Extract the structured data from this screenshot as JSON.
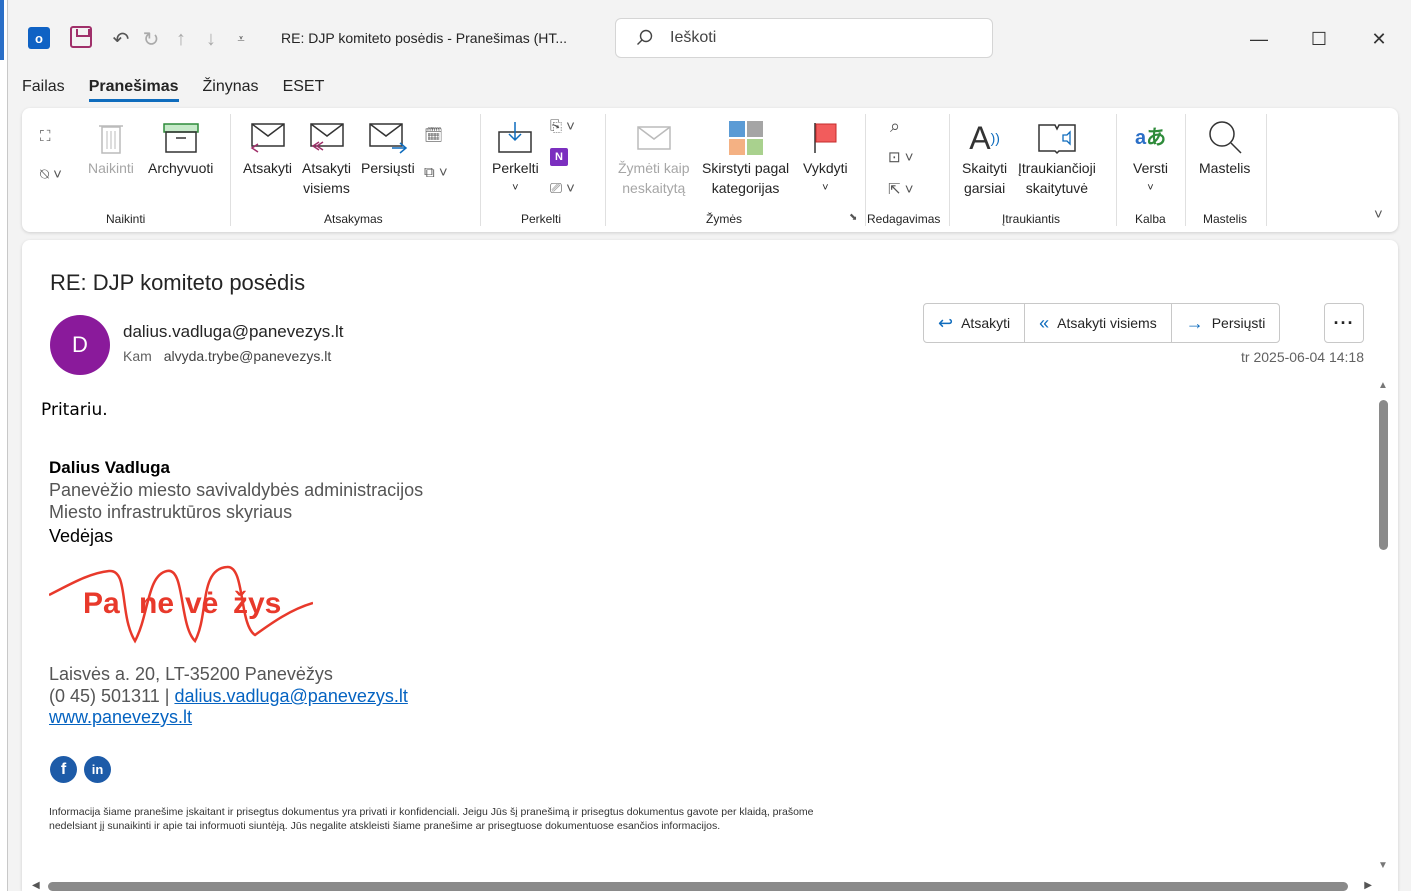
{
  "window": {
    "title": "RE: DJP komiteto posėdis - Pranešimas (HT...",
    "search_placeholder": "Ieškoti"
  },
  "menu_tabs": [
    "Failas",
    "Pranešimas",
    "Žinynas",
    "ESET"
  ],
  "active_tab": "Pranešimas",
  "ribbon": {
    "groups": {
      "naikinti": "Naikinti",
      "atsakymas": "Atsakymas",
      "perkelti": "Perkelti",
      "zymes": "Žymės",
      "redagavimas": "Redagavimas",
      "itraukiantis": "Įtraukiantis",
      "kalba": "Kalba",
      "mastelis": "Mastelis"
    },
    "buttons": {
      "naikinti": "Naikinti",
      "archyvuoti": "Archyvuoti",
      "atsakyti": "Atsakyti",
      "atsakyti_visiems_1": "Atsakyti",
      "atsakyti_visiems_2": "visiems",
      "persiusti": "Persiųsti",
      "perkelti": "Perkelti",
      "zymeti_1": "Žymėti kaip",
      "zymeti_2": "neskaitytą",
      "skirstyti_1": "Skirstyti pagal",
      "skirstyti_2": "kategorijas",
      "vykdyti": "Vykdyti",
      "skaityti_1": "Skaityti",
      "skaityti_2": "garsiai",
      "itraukiancioji_1": "Įtraukiančioji",
      "itraukiancioji_2": "skaitytuvė",
      "versti": "Versti",
      "mastelis": "Mastelis"
    }
  },
  "message": {
    "subject": "RE: DJP komiteto posėdis",
    "avatar_letter": "D",
    "from": "dalius.vadluga@panevezys.lt",
    "to_label": "Kam",
    "to": "alvyda.trybe@panevezys.lt",
    "date": "tr 2025-06-04 14:18",
    "actions": {
      "reply": "Atsakyti",
      "reply_all": "Atsakyti visiems",
      "forward": "Persiųsti",
      "more": "···"
    },
    "body": "Pritariu.",
    "signature": {
      "name": "Dalius Vadluga",
      "org_1": "Panevėžio miesto savivaldybės administracijos",
      "org_2": "Miesto infrastruktūros skyriaus",
      "role": "Vedėjas",
      "logo_text": "Panevėžys",
      "address": "Laisvės a. 20, LT-35200 Panevėžys",
      "phone": "(0 45) 501311 | ",
      "email": "dalius.vadluga@panevezys.lt",
      "website": "www.panevezys.lt",
      "disclaimer": "Informacija šiame pranešime įskaitant ir prisegtus dokumentus yra privati ir konfidenciali. Jeigu Jūs šį pranešimą ir prisegtus dokumentus gavote per klaidą, prašome nedelsiant jį sunaikinti ir apie tai informuoti siuntėją. Jūs negalite atskleisti šiame pranešime ar prisegtuose dokumentuose esančios informacijos."
    }
  },
  "colors": {
    "accent": "#0f6cbd",
    "avatar": "#8a1a9b",
    "logo_red": "#e8392b",
    "facebook": "#1d5ba8"
  }
}
